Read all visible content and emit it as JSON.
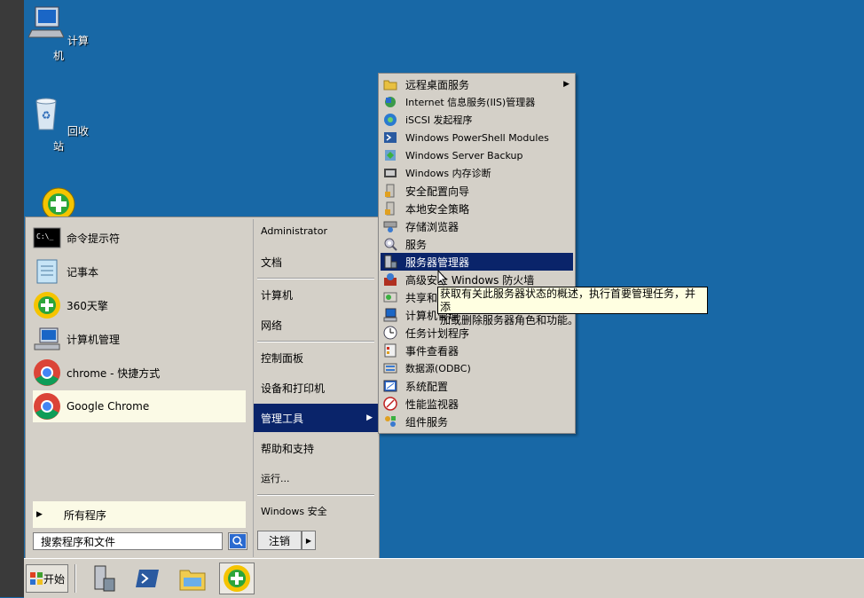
{
  "desktop": {
    "icons": [
      {
        "label": "计算机",
        "icon": "computer-icon"
      },
      {
        "label": "回收站",
        "icon": "recycle-bin-icon"
      },
      {
        "label": "",
        "icon": "360-browser-icon"
      }
    ]
  },
  "start_menu": {
    "pinned": [
      {
        "label": "命令提示符",
        "icon": "cmd-icon"
      },
      {
        "label": "记事本",
        "icon": "notepad-icon"
      },
      {
        "label": "360天擎",
        "icon": "360-icon"
      },
      {
        "label": "计算机管理",
        "icon": "computer-management-icon"
      },
      {
        "label": "chrome - 快捷方式",
        "icon": "chrome-icon"
      },
      {
        "label": "Google Chrome",
        "icon": "chrome-icon"
      }
    ],
    "all_programs": "所有程序",
    "search_placeholder": "搜索程序和文件",
    "right": {
      "user": "Administrator",
      "documents": "文档",
      "computer": "计算机",
      "network": "网络",
      "control_panel": "控制面板",
      "devices_printers": "设备和打印机",
      "admin_tools": "管理工具",
      "help": "帮助和支持",
      "run": "运行...",
      "windows_security": "Windows 安全",
      "logout": "注销"
    }
  },
  "admin_tools_menu": [
    {
      "label": "远程桌面服务",
      "icon": "folder-icon",
      "has_submenu": true
    },
    {
      "label": "Internet 信息服务(IIS)管理器",
      "icon": "iis-icon"
    },
    {
      "label": "iSCSI 发起程序",
      "icon": "iscsi-icon"
    },
    {
      "label": "Windows PowerShell Modules",
      "icon": "powershell-icon"
    },
    {
      "label": "Windows Server Backup",
      "icon": "backup-icon"
    },
    {
      "label": "Windows 内存诊断",
      "icon": "memory-diagnostic-icon"
    },
    {
      "label": "安全配置向导",
      "icon": "security-wizard-icon"
    },
    {
      "label": "本地安全策略",
      "icon": "local-security-policy-icon"
    },
    {
      "label": "存储浏览器",
      "icon": "storage-explorer-icon"
    },
    {
      "label": "服务",
      "icon": "services-icon"
    },
    {
      "label": "服务器管理器",
      "icon": "server-manager-icon",
      "highlighted": true
    },
    {
      "label": "高级安全 Windows 防火墙",
      "icon": "firewall-icon"
    },
    {
      "label": "共享和存储管理",
      "icon": "share-storage-icon"
    },
    {
      "label": "计算机管理",
      "icon": "computer-management-icon"
    },
    {
      "label": "任务计划程序",
      "icon": "task-scheduler-icon"
    },
    {
      "label": "事件查看器",
      "icon": "event-viewer-icon"
    },
    {
      "label": "数据源(ODBC)",
      "icon": "odbc-icon"
    },
    {
      "label": "系统配置",
      "icon": "system-config-icon"
    },
    {
      "label": "性能监视器",
      "icon": "performance-monitor-icon"
    },
    {
      "label": "组件服务",
      "icon": "component-services-icon"
    }
  ],
  "tooltip": {
    "line1": "获取有关此服务器状态的概述，执行首要管理任务，并添",
    "line2": "加或删除服务器角色和功能。"
  },
  "taskbar": {
    "start_label": "开始",
    "buttons": [
      {
        "icon": "server-manager-icon"
      },
      {
        "icon": "powershell-icon"
      },
      {
        "icon": "explorer-icon"
      },
      {
        "icon": "360-browser-icon",
        "active": true
      }
    ]
  }
}
